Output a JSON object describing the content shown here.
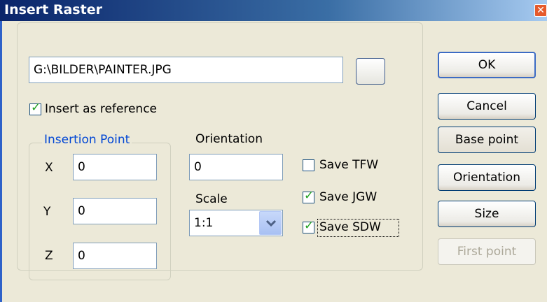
{
  "window": {
    "title": "Insert Raster",
    "close_glyph": "✕"
  },
  "file": {
    "path": "G:\\BILDER\\PAINTER.JPG"
  },
  "insert_as_reference": {
    "label": "Insert as reference",
    "checked": true
  },
  "insertion_point": {
    "title": "Insertion Point",
    "x_label": "X",
    "x_value": "0",
    "y_label": "Y",
    "y_value": "0",
    "z_label": "Z",
    "z_value": "0"
  },
  "orientation": {
    "label": "Orientation",
    "value": "0"
  },
  "scale": {
    "label": "Scale",
    "value": "1:1"
  },
  "save_options": [
    {
      "label": "Save TFW",
      "checked": false
    },
    {
      "label": "Save JGW",
      "checked": true
    },
    {
      "label": "Save SDW",
      "checked": true
    }
  ],
  "buttons": {
    "ok": "OK",
    "cancel": "Cancel",
    "base_point": "Base point",
    "orientation": "Orientation",
    "size": "Size",
    "first_point": "First point"
  },
  "colors": {
    "title_bar": "#0A246A",
    "group_title": "#0046D5",
    "check_mark": "#21A121"
  }
}
